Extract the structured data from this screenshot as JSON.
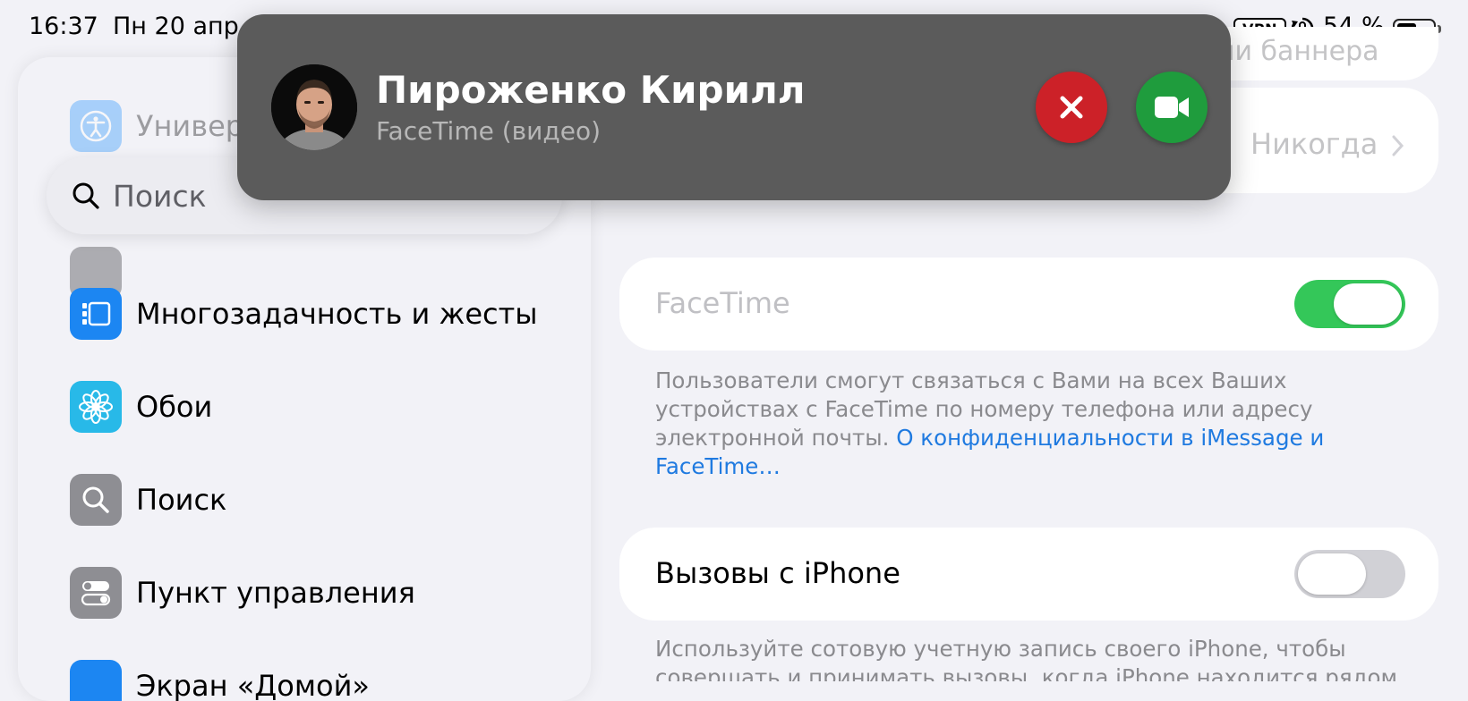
{
  "status_bar": {
    "time": "16:37",
    "date": "Пн 20 апр",
    "vpn": "VPN",
    "battery_percent": "54 %",
    "battery_level": 0.54,
    "icons": [
      "vpn-icon",
      "orientation-lock-icon",
      "battery-icon"
    ]
  },
  "sidebar": {
    "search_placeholder": "Поиск",
    "items": [
      {
        "label": "Универ",
        "icon": "accessibility-icon",
        "color": "#1e90ff"
      },
      {
        "label": "",
        "icon": "gray-settings-icon",
        "color": "#8e8e93"
      },
      {
        "label": "Многозадачность и жесты",
        "icon": "multitasking-icon",
        "color": "#1c86f2"
      },
      {
        "label": "Обои",
        "icon": "flower-icon",
        "color": "#28b9e8"
      },
      {
        "label": "Поиск",
        "icon": "search-icon",
        "color": "#8e8e93"
      },
      {
        "label": "Пункт управления",
        "icon": "toggles-icon",
        "color": "#8e8e93"
      },
      {
        "label": "Экран «Домой»",
        "icon": "home-screen-icon",
        "color": "#1c86f2"
      }
    ]
  },
  "main": {
    "top_row_partial": "ии баннера",
    "never_row_value": "Никогда",
    "facetime_row": {
      "label": "FaceTime",
      "toggle_on": true
    },
    "facetime_footnote": "Пользователи смогут связаться с Вами на всех Ваших устройствах с FaceTime по номеру телефона или адресу электронной почты. ",
    "facetime_footnote_link": "О конфиденциальности в iMessage и FaceTime…",
    "iphone_calls_row": {
      "label": "Вызовы с iPhone",
      "toggle_on": false
    },
    "iphone_calls_footnote": "Используйте сотовую учетную запись своего iPhone, чтобы совершать и принимать вызовы, когда iPhone находится рядом"
  },
  "incoming_call": {
    "caller_name": "Пироженко Кирилл",
    "call_type": "FaceTime (видео)",
    "decline_color": "#cc2128",
    "accept_color": "#1f9c3d",
    "toggle_on_color": "#34c759",
    "toggle_off_color": "#d1d1d6"
  }
}
